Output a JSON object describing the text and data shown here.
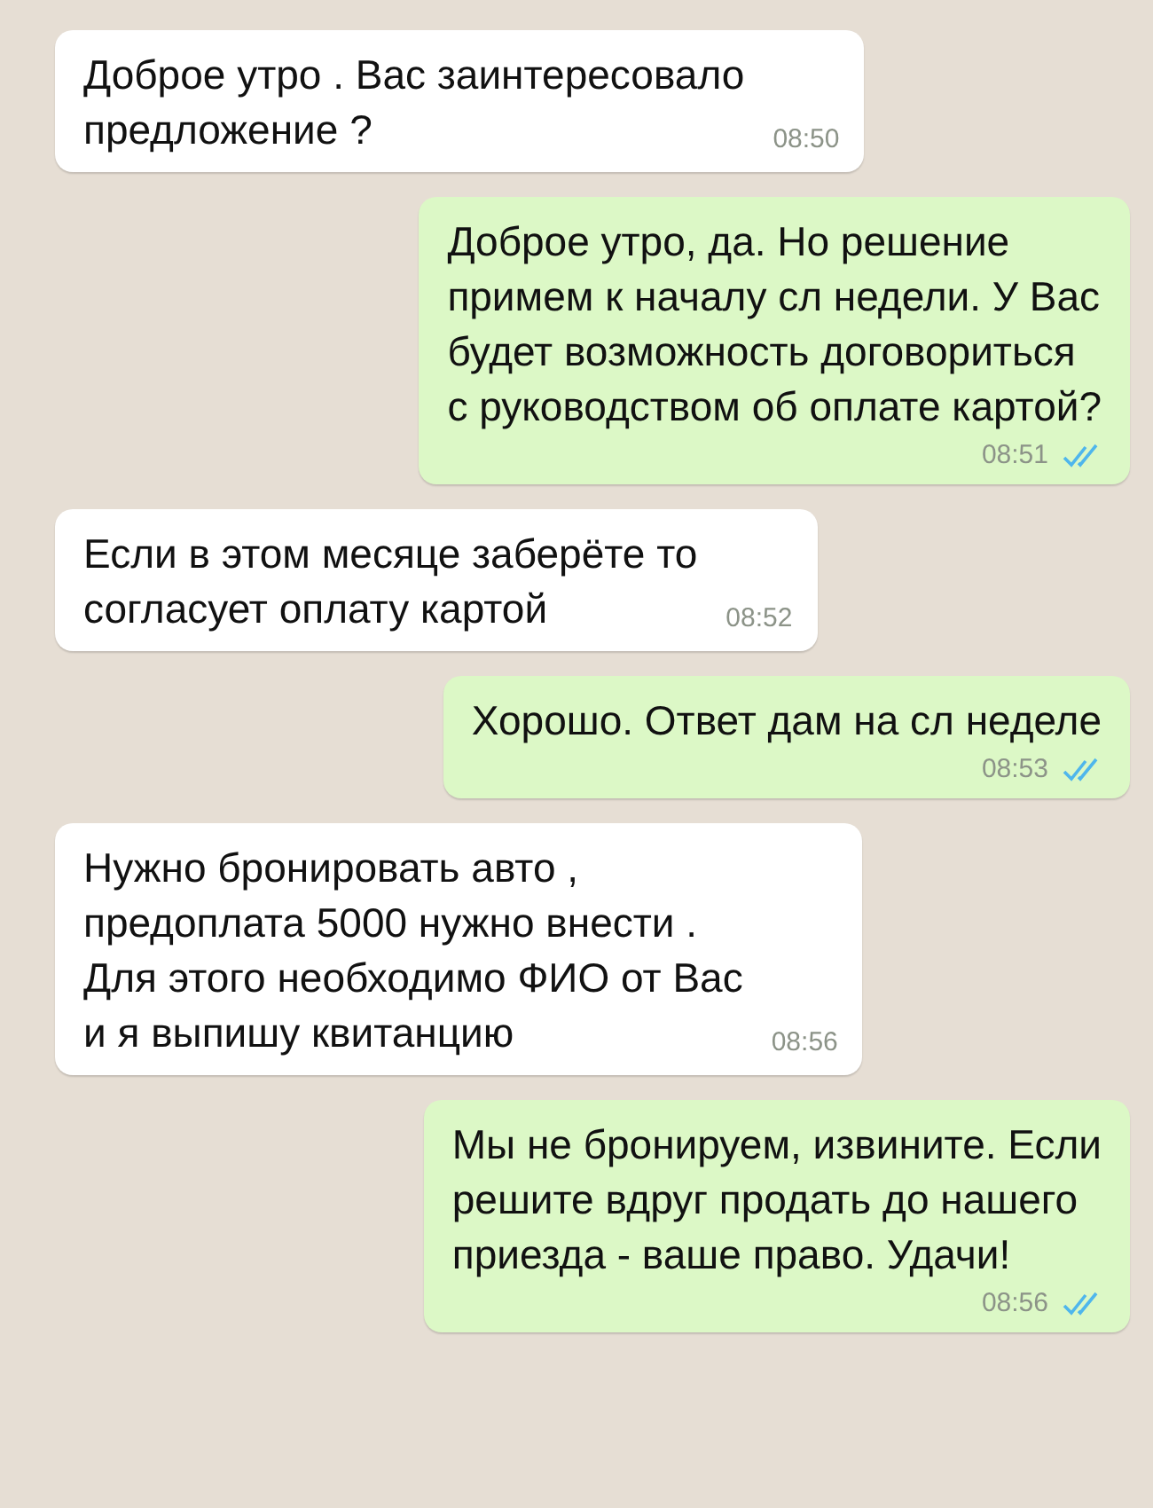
{
  "messages": [
    {
      "outgoing": false,
      "text": "Доброе утро . Вас заинтересовало\nпредложение ?",
      "time": "08:50"
    },
    {
      "outgoing": true,
      "text": "Доброе утро, да. Но решение\nпримем к началу сл недели. У Вас\nбудет возможность договориться\nс руководством об оплате картой?",
      "time": "08:51",
      "read": true
    },
    {
      "outgoing": false,
      "text": "Если в этом месяце заберёте то\nсогласует оплату картой",
      "time": "08:52"
    },
    {
      "outgoing": true,
      "text": "Хорошо. Ответ дам на сл неделе",
      "time": "08:53",
      "read": true
    },
    {
      "outgoing": false,
      "text": "Нужно бронировать авто ,\nпредоплата 5000 нужно внести .\nДля этого необходимо ФИО от Вас\nи я выпишу квитанцию",
      "time": "08:56"
    },
    {
      "outgoing": true,
      "text": "Мы не бронируем, извините. Если\nрешите вдруг продать до нашего\nприезда - ваше право. Удачи!",
      "time": "08:56",
      "read": true
    }
  ]
}
